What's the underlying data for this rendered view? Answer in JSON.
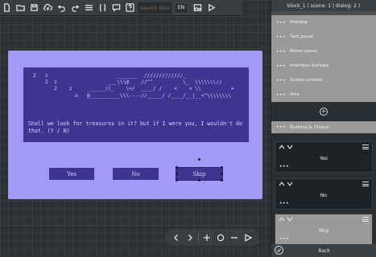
{
  "toolbar": {
    "icons": [
      "file-icon",
      "folder-open-icon",
      "save-icon",
      "cloud-upload-icon",
      "undo-icon",
      "redo-icon",
      "sliders-icon",
      "braces-icon",
      "comment-icon",
      "help-icon"
    ],
    "search_placeholder": "search block",
    "language": "EN"
  },
  "dialog": {
    "ascii_art": "Z   z                       _______  /////////////_\n    Z  z                 ___\\\\\\@    //^^          \\_  \\\\\\\\\\\\\\//\n       Z    z      _____/(_    \\=/  ____/ /    <    < \\\\          >\n              o   @__________\\\\\\----//_____/ /____/__|__<^\\\\\\\\\\\\\\\\",
    "text": "Shall we look for treasures in it? but if I were you, I wouldn't do\nthat. (Y / N)",
    "choices": [
      "Yes",
      "No",
      "Skip"
    ]
  },
  "bottom_nav": {
    "icons": [
      "chevron-left-icon",
      "chevron-right-icon",
      "plus-icon",
      "circle-icon",
      "minus-icon",
      "play-icon"
    ]
  },
  "panel": {
    "header": "block_1 ( scene: 1 | dialog: 2 )",
    "items": [
      "Preview",
      "Text panel",
      "Name panel",
      "Interface buttons",
      "Scene content",
      "Arts"
    ],
    "section": "Buttons & Choice",
    "choice_cards": [
      "Yes",
      "No",
      "Skip"
    ],
    "back": "Back"
  },
  "colors": {
    "frame": "#a29bf5",
    "text_box": "#3f3591",
    "text": "#d8d2ff"
  }
}
